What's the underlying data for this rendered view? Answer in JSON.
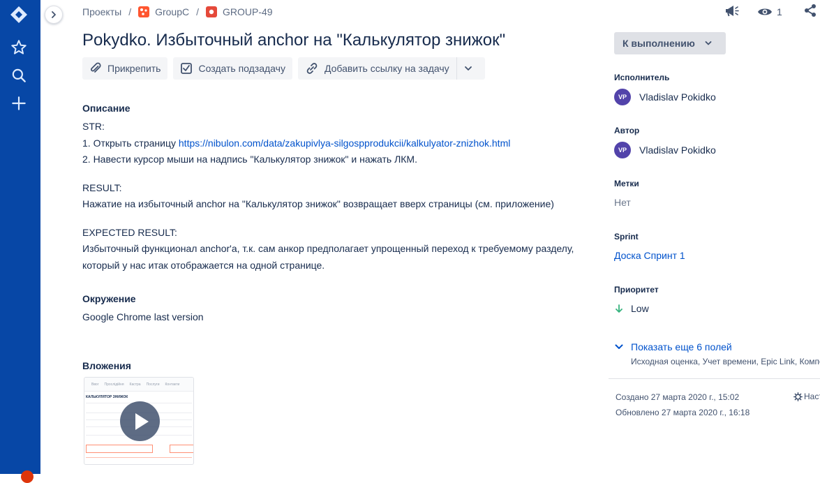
{
  "breadcrumbs": {
    "root": "Проекты",
    "project": "GroupC",
    "issue_key": "GROUP-49"
  },
  "header": {
    "watch_count": "1"
  },
  "issue": {
    "title": "Pokydko. Избыточный anchor на \"Калькулятор знижок\""
  },
  "actions": {
    "attach": "Прикрепить",
    "subtask": "Создать подзадачу",
    "link_issue": "Добавить ссылку на задачу"
  },
  "description": {
    "heading": "Описание",
    "str_label": "STR:",
    "step1_prefix": "1. Открыть страницу ",
    "step1_link": "https://nibulon.com/data/zakupivlya-silgospprodukcii/kalkulyator-znizhok.html",
    "step2": "2. Навести курсор мыши на надпись \"Калькулятор знижок\" и нажать ЛКМ.",
    "result_label": "RESULT:",
    "result_text": "Нажатие на избыточный anchor на \"Калькулятор знижок\" возвращает вверх страницы (см. приложение)",
    "expected_label": "EXPECTED RESULT:",
    "expected_line1": "Избыточный функционал anchor'а, т.к. сам анкор предполагает упрощенный переход к требуемому разделу,",
    "expected_line2": "который у нас итак отображается на одной странице."
  },
  "environment": {
    "heading": "Окружение",
    "value": "Google Chrome last version"
  },
  "attachments": {
    "heading": "Вложения",
    "thumb_menu": [
      "Ввог",
      "Прослідійня",
      "Кастра",
      "Послуги",
      "Контакти"
    ],
    "thumb_heading": "калькулятор знижок"
  },
  "sidebar": {
    "status": "К выполнению",
    "assignee_label": "Исполнитель",
    "assignee_initials": "VP",
    "assignee_name": "Vladislav Pokidko",
    "reporter_label": "Автор",
    "reporter_initials": "VP",
    "reporter_name": "Vladislav Pokidko",
    "labels_label": "Метки",
    "labels_value": "Нет",
    "sprint_label": "Sprint",
    "sprint_value": "Доска Спринт 1",
    "priority_label": "Приоритет",
    "priority_value": "Low",
    "more_fields": "Показать еще 6 полей",
    "more_fields_sub": "Исходная оценка, Учет времени, Epic Link, Компо",
    "created": "Создано 27 марта 2020 г., 15:02",
    "updated": "Обновлено 27 марта 2020 г., 16:18",
    "configure": "Наст"
  },
  "colors": {
    "nav_bg": "#0747a6",
    "link": "#0052cc",
    "avatar": "#5243aa",
    "priority_low": "#36b37e"
  },
  "icons": {
    "nav": [
      "jira-logo-icon",
      "star-icon",
      "search-icon",
      "plus-icon"
    ],
    "header": [
      "announcement-icon",
      "eye-icon",
      "share-icon"
    ]
  }
}
